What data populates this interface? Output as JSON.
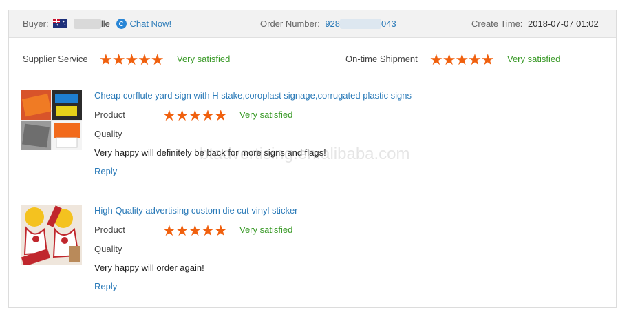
{
  "header": {
    "buyer_label": "Buyer:",
    "buyer_name_fragment": "lle",
    "chat_label": "Chat Now!",
    "order_label": "Order Number:",
    "order_prefix": "928",
    "order_suffix": "043",
    "create_label": "Create Time:",
    "create_time": "2018-07-07 01:02"
  },
  "ratings": {
    "supplier_label": "Supplier Service",
    "supplier_result": "Very satisfied",
    "shipment_label": "On-time Shipment",
    "shipment_result": "Very satisfied",
    "stars_glyph": "★★★★★",
    "star_color": "#f0600e"
  },
  "reviews": [
    {
      "title": "Cheap corflute yard sign with H stake,coroplast signage,corrugated plastic signs",
      "product_label": "Product",
      "product_result": "Very satisfied",
      "quality_label": "Quality",
      "comment": "Very happy will definitely be back for more signs and flags!",
      "reply_label": "Reply"
    },
    {
      "title": "High Quality advertising custom die cut vinyl sticker",
      "product_label": "Product",
      "product_result": "Very satisfied",
      "quality_label": "Quality",
      "comment": "Very happy will order again!",
      "reply_label": "Reply"
    }
  ],
  "watermark": "btadvertising.en.alibaba.com",
  "colors": {
    "link": "#2a7ab8",
    "satisfied": "#3a9a28",
    "header_bg": "#f2f2f2"
  }
}
